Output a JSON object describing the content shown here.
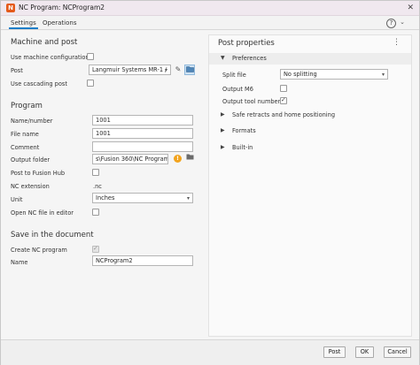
{
  "window": {
    "title": "NC Program: NCProgram2",
    "app_icon": "N",
    "close_glyph": "✕"
  },
  "tabs": [
    {
      "label": "Settings",
      "active": true
    },
    {
      "label": "Operations",
      "active": false
    }
  ],
  "help": {
    "glyph": "?",
    "chevron": "⌄"
  },
  "machine_post": {
    "title": "Machine and post",
    "use_machine_config_label": "Use machine configuration",
    "post_label": "Post",
    "post_value": "Langmuir Systems MR-1 /",
    "use_cascading_post_label": "Use cascading post"
  },
  "program": {
    "title": "Program",
    "name_number_label": "Name/number",
    "name_number_value": "1001",
    "file_name_label": "File name",
    "file_name_value": "1001",
    "comment_label": "Comment",
    "comment_value": "",
    "output_folder_label": "Output folder",
    "output_folder_value": "s\\Fusion 360\\NC Programs",
    "post_to_hub_label": "Post to Fusion Hub",
    "nc_extension_label": "NC extension",
    "nc_extension_value": ".nc",
    "unit_label": "Unit",
    "unit_value": "Inches",
    "open_nc_label": "Open NC file in editor"
  },
  "save_doc": {
    "title": "Save in the document",
    "create_nc_label": "Create NC program",
    "name_label": "Name",
    "name_value": "NCProgram2"
  },
  "post_properties": {
    "title": "Post properties",
    "menu_glyph": "⋮",
    "preferences_label": "Preferences",
    "split_file_label": "Split file",
    "split_file_value": "No splitting",
    "output_m6_label": "Output M6",
    "output_tool_number_label": "Output tool number",
    "groups": [
      "Safe retracts and home positioning",
      "Formats",
      "Built-in"
    ]
  },
  "footer": {
    "post_label": "Post",
    "ok_label": "OK",
    "cancel_label": "Cancel"
  },
  "colors": {
    "accent": "#1b7ec8",
    "app_icon": "#e45a1a",
    "warning": "#f2a31c"
  }
}
